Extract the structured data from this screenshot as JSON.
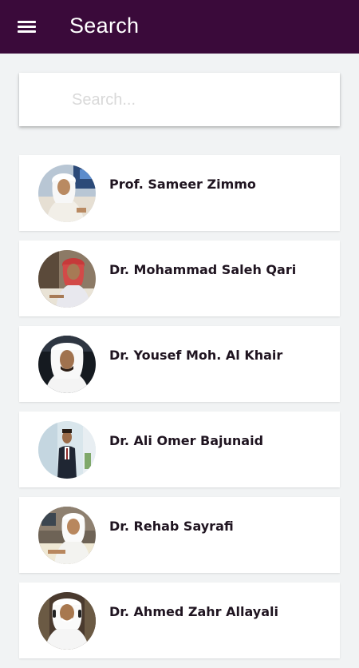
{
  "header": {
    "title": "Search",
    "background_color": "#3a0a3a"
  },
  "search": {
    "placeholder": "Search..."
  },
  "doctors": [
    {
      "name": "Prof. Sameer Zimmo"
    },
    {
      "name": "Dr. Mohammad Saleh Qari"
    },
    {
      "name": "Dr. Yousef Moh. Al Khair"
    },
    {
      "name": "Dr. Ali Omer Bajunaid"
    },
    {
      "name": "Dr. Rehab Sayrafi"
    },
    {
      "name": "Dr. Ahmed Zahr Allayali"
    }
  ]
}
